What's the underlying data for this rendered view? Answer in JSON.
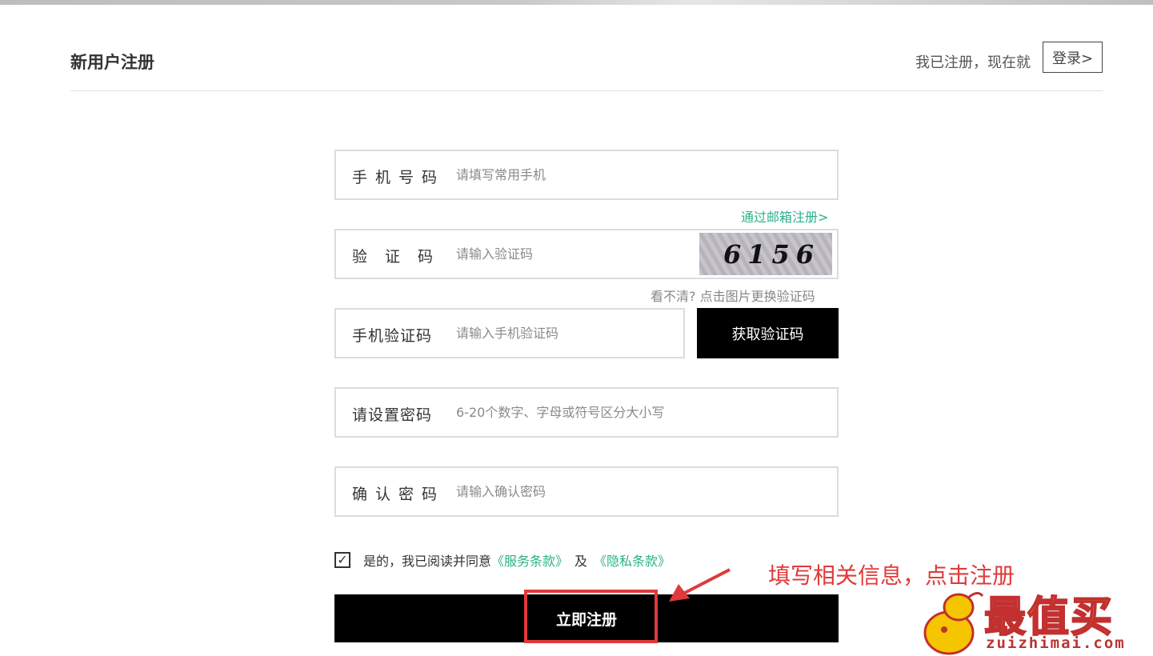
{
  "header": {
    "title": "新用户注册",
    "login_prompt": "我已注册，现在就",
    "login_button": "登录>"
  },
  "form": {
    "phone": {
      "label": "手机号码",
      "placeholder": "请填写常用手机"
    },
    "email_link": "通过邮箱注册>",
    "captcha": {
      "label": "验证码",
      "placeholder": "请输入验证码",
      "image_text": "6156",
      "refresh_hint": "看不清? 点击图片更换验证码"
    },
    "sms_code": {
      "label": "手机验证码",
      "placeholder": "请输入手机验证码",
      "button": "获取验证码"
    },
    "password": {
      "label": "请设置密码",
      "placeholder": "6-20个数字、字母或符号区分大小写"
    },
    "confirm_password": {
      "label": "确认密码",
      "placeholder": "请输入确认密码"
    },
    "agree": {
      "checked": true,
      "text": "是的，我已阅读并同意",
      "service_terms": "《服务条款》",
      "and": "及",
      "privacy_terms": "《隐私条款》"
    },
    "submit_button": "立即注册"
  },
  "annotation": {
    "text": "填写相关信息，点击注册",
    "color": "#e03a3a"
  },
  "watermark": {
    "logo_text": "最值买",
    "domain": "zuizhimai.com"
  },
  "colors": {
    "accent_link": "#2bb08a",
    "button_bg": "#000000",
    "annotation": "#e03a3a"
  }
}
